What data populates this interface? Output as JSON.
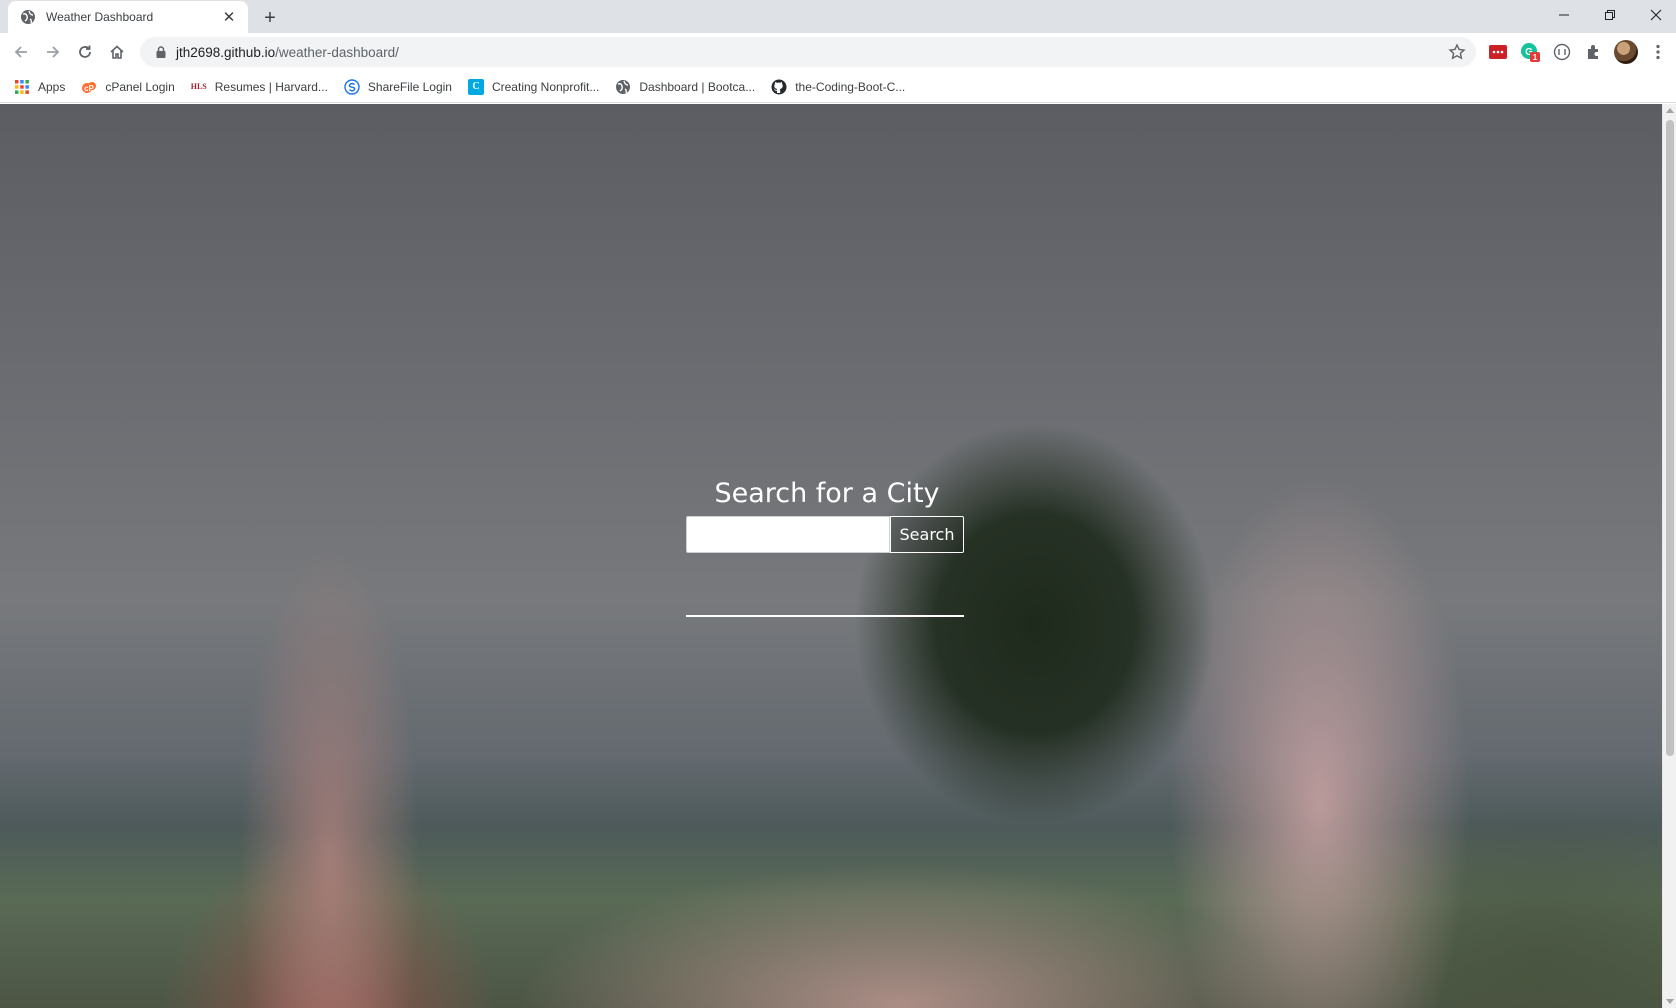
{
  "browser": {
    "tab": {
      "title": "Weather Dashboard"
    },
    "url": {
      "host": "jth2698.github.io",
      "path": "/weather-dashboard/"
    },
    "extensions": [
      {
        "icon": "lastpass-icon"
      },
      {
        "icon": "grammarly-icon",
        "badge": "1"
      },
      {
        "icon": "circle-extension-icon"
      },
      {
        "icon": "puzzle-icon"
      }
    ],
    "bookmarks": [
      {
        "label": "Apps",
        "icon": "apps-grid-icon"
      },
      {
        "label": "cPanel Login",
        "icon": "cpanel-icon"
      },
      {
        "label": "Resumes | Harvard...",
        "icon": "harvard-hls-icon",
        "icon_text": "HLS"
      },
      {
        "label": "ShareFile Login",
        "icon": "sharefile-icon"
      },
      {
        "label": "Creating Nonprofit...",
        "icon": "canvas-c-icon",
        "icon_text": "C"
      },
      {
        "label": "Dashboard | Bootca...",
        "icon": "globe-icon"
      },
      {
        "label": "the-Coding-Boot-C...",
        "icon": "github-icon"
      }
    ]
  },
  "page": {
    "heading": "Search for a City",
    "search": {
      "value": "",
      "placeholder": "",
      "button_label": "Search"
    }
  }
}
